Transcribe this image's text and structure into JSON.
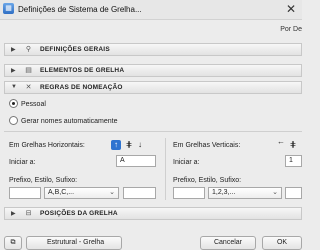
{
  "window": {
    "title": "Definições de Sistema de Grelha..."
  },
  "top_right_text": "Por De",
  "sections": {
    "general": "DEFINIÇÕES GERAIS",
    "elements": "ELEMENTOS DE GRELHA",
    "naming": "REGRAS DE NOMEAÇÃO",
    "positions": "POSIÇÕES DA GRELHA"
  },
  "naming": {
    "option_personal": "Pessoal",
    "option_auto": "Gerar nomes automaticamente",
    "horizontal": {
      "title": "Em Grelhas Horizontais:",
      "start_label": "Iniciar a:",
      "start_value": "A",
      "prefix_label": "Prefixo, Estilo, Sufixo:",
      "style_value": "A,B,C,..."
    },
    "vertical": {
      "title": "Em Grelhas Verticais:",
      "start_label": "Iniciar a:",
      "start_value": "1",
      "prefix_label": "Prefixo, Estilo, Sufixo:",
      "style_value": "1,2,3,..."
    }
  },
  "footer": {
    "layer_value": "Estrutural - Grelha",
    "cancel_label": "Cancelar",
    "ok_label": "OK"
  }
}
